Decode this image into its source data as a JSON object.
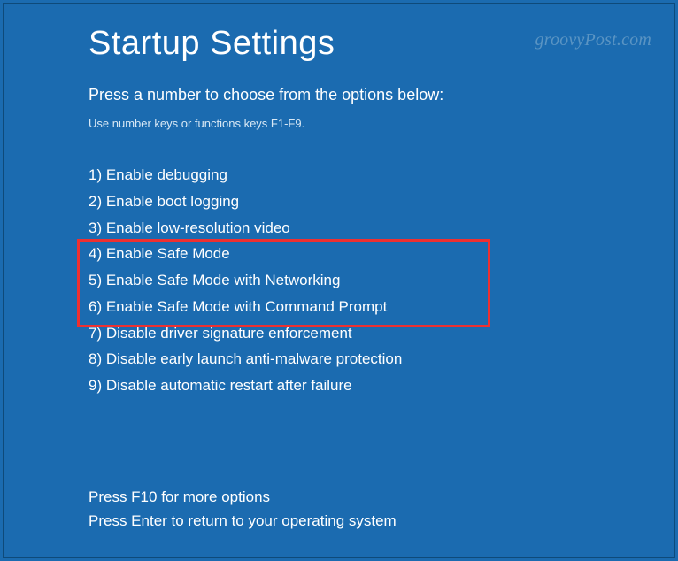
{
  "title": "Startup Settings",
  "subtitle": "Press a number to choose from the options below:",
  "hint": "Use number keys or functions keys F1-F9.",
  "options": [
    "1) Enable debugging",
    "2) Enable boot logging",
    "3) Enable low-resolution video",
    "4) Enable Safe Mode",
    "5) Enable Safe Mode with Networking",
    "6) Enable Safe Mode with Command Prompt",
    "7) Disable driver signature enforcement",
    "8) Disable early launch anti-malware protection",
    "9) Disable automatic restart after failure"
  ],
  "footer": {
    "line1": "Press F10 for more options",
    "line2": "Press Enter to return to your operating system"
  },
  "watermark": "groovyPost.com"
}
